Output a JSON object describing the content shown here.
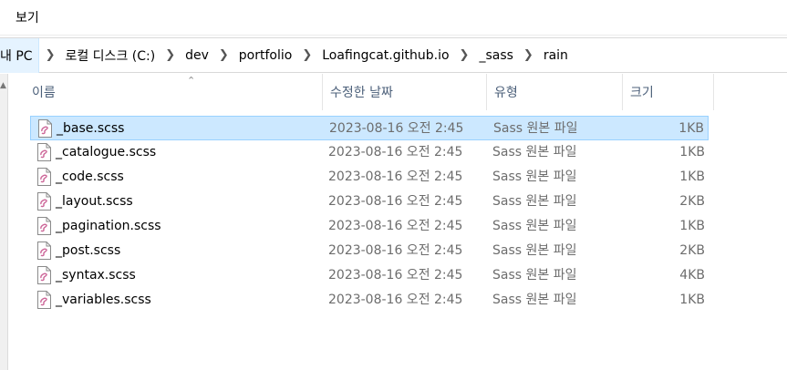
{
  "menubar": {
    "view_label": "보기"
  },
  "address": {
    "crumbs": [
      "내 PC",
      "로컬 디스크 (C:)",
      "dev",
      "portfolio",
      "Loafingcat.github.io",
      "_sass",
      "rain"
    ]
  },
  "columns": {
    "name": "이름",
    "date": "수정한 날짜",
    "type": "유형",
    "size": "크기"
  },
  "files": [
    {
      "name": "_base.scss",
      "date": "2023-08-16 오전 2:45",
      "type": "Sass 원본 파일",
      "size": "1KB",
      "selected": true
    },
    {
      "name": "_catalogue.scss",
      "date": "2023-08-16 오전 2:45",
      "type": "Sass 원본 파일",
      "size": "1KB"
    },
    {
      "name": "_code.scss",
      "date": "2023-08-16 오전 2:45",
      "type": "Sass 원본 파일",
      "size": "1KB"
    },
    {
      "name": "_layout.scss",
      "date": "2023-08-16 오전 2:45",
      "type": "Sass 원본 파일",
      "size": "2KB"
    },
    {
      "name": "_pagination.scss",
      "date": "2023-08-16 오전 2:45",
      "type": "Sass 원본 파일",
      "size": "1KB"
    },
    {
      "name": "_post.scss",
      "date": "2023-08-16 오전 2:45",
      "type": "Sass 원본 파일",
      "size": "2KB"
    },
    {
      "name": "_syntax.scss",
      "date": "2023-08-16 오전 2:45",
      "type": "Sass 원본 파일",
      "size": "4KB"
    },
    {
      "name": "_variables.scss",
      "date": "2023-08-16 오전 2:45",
      "type": "Sass 원본 파일",
      "size": "1KB"
    }
  ],
  "icons": {
    "file_icon": "sass-file-icon",
    "separator": "chevron-right-icon",
    "sort": "sort-ascending-icon"
  },
  "colors": {
    "selection": "#cce8ff",
    "selection_border": "#99d1ff",
    "header_text": "#4c607a",
    "sass_icon": "#cd6799"
  }
}
